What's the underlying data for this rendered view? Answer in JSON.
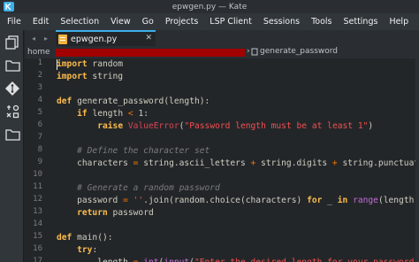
{
  "window": {
    "title": "epwgen.py — Kate"
  },
  "menubar": {
    "items": [
      "File",
      "Edit",
      "Selection",
      "View",
      "Go",
      "Projects",
      "LSP Client",
      "Sessions",
      "Tools",
      "Settings",
      "Help"
    ]
  },
  "tabbar": {
    "back_icon": "left-arrow-icon",
    "forward_icon": "right-arrow-icon",
    "active_tab": "epwgen.py"
  },
  "breadcrumb": {
    "home": "home",
    "function": "generate_password"
  },
  "editor": {
    "line_numbers": [
      "1",
      "2",
      "3",
      "4",
      "5",
      "6",
      "7",
      "8",
      "9",
      "10",
      "11",
      "12",
      "13",
      "14",
      "15",
      "16",
      "17"
    ],
    "lines": [
      [
        "import random"
      ],
      [
        "import string"
      ],
      [
        ""
      ],
      [
        "def generate_password(length):"
      ],
      [
        "    if length < 1:"
      ],
      [
        "        raise ValueError(\"Password length must be at least 1\")"
      ],
      [
        ""
      ],
      [
        "    # Define the character set"
      ],
      [
        "    characters = string.ascii_letters + string.digits + string.punctuation"
      ],
      [
        ""
      ],
      [
        "    # Generate a random password"
      ],
      [
        "    password = ''.join(random.choice(characters) for _ in range(length))"
      ],
      [
        "    return password"
      ],
      [
        ""
      ],
      [
        "def main():"
      ],
      [
        "    try:"
      ],
      [
        "        length = int(input(\"Enter the desired length for your password: \"))"
      ]
    ]
  },
  "colors": {
    "accent": "#3daee9",
    "keyword": "#fdbc4b",
    "string": "#f44f4f",
    "comment": "#7a7c7d",
    "redaction": "#a00000"
  }
}
